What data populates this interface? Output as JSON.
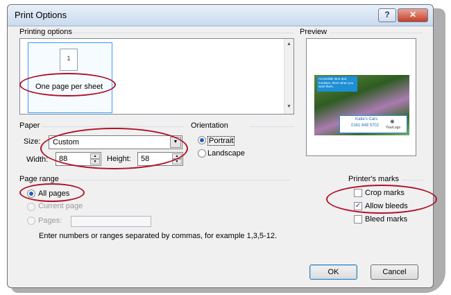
{
  "window": {
    "title": "Print Options",
    "help_label": "?",
    "close_label": "✕"
  },
  "printing_options": {
    "label": "Printing options",
    "items": [
      {
        "page_number": "1",
        "label": "One page per sheet"
      }
    ]
  },
  "preview": {
    "label": "Preview",
    "banner_text": "Accessible lane and modules, there when you want them.",
    "card_name": "Katie's Cars",
    "card_phone": "0161 848 5702",
    "logo_text": "YourLogo"
  },
  "paper": {
    "label": "Paper",
    "size_label": "Size:",
    "size_value": "Custom",
    "width_label": "Width:",
    "width_value": "88",
    "height_label": "Height:",
    "height_value": "58"
  },
  "orientation": {
    "label": "Orientation",
    "portrait_label": "Portrait",
    "landscape_label": "Landscape",
    "selected": "Portrait"
  },
  "page_range": {
    "label": "Page range",
    "all_pages_label": "All pages",
    "current_page_label": "Current page",
    "pages_label": "Pages:",
    "pages_value": "",
    "hint": "Enter numbers or ranges separated by commas, for example 1,3,5-12."
  },
  "printers_marks": {
    "label": "Printer's marks",
    "crop_marks_label": "Crop marks",
    "crop_marks_checked": false,
    "allow_bleeds_label": "Allow bleeds",
    "allow_bleeds_checked": true,
    "bleed_marks_label": "Bleed marks",
    "bleed_marks_checked": false
  },
  "buttons": {
    "ok_label": "OK",
    "cancel_label": "Cancel"
  },
  "colors": {
    "annotation": "#b0112a",
    "title_bar": "#c9daee",
    "dialog_bg": "#f0f0f0"
  }
}
